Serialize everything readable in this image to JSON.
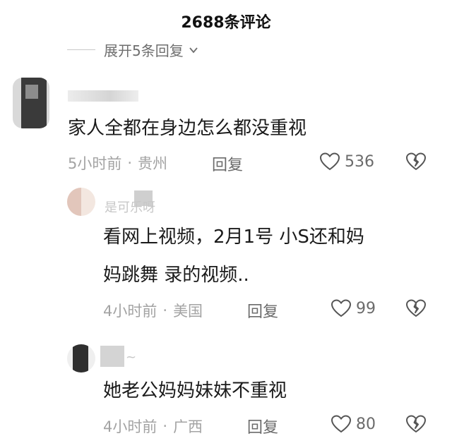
{
  "header": {
    "title": "2688条评论"
  },
  "expand": {
    "label": "展开5条回复"
  },
  "comments": [
    {
      "username": "",
      "text_lines": [
        "家人全都在身边怎么都没重视"
      ],
      "time": "5小时前",
      "location": "贵州",
      "reply_label": "回复",
      "likes": "536"
    },
    {
      "username": "是可乐呀",
      "text_lines": [
        "看网上视频，2月1号 小S还和妈",
        "妈跳舞 录的视频.."
      ],
      "time": "4小时前",
      "location": "美国",
      "reply_label": "回复",
      "likes": "99"
    },
    {
      "username": "~",
      "text_lines": [
        "她老公妈妈妹妹不重视"
      ],
      "time": "4小时前",
      "location": "广西",
      "reply_label": "回复",
      "likes": "80"
    }
  ],
  "meta_separator": "·"
}
